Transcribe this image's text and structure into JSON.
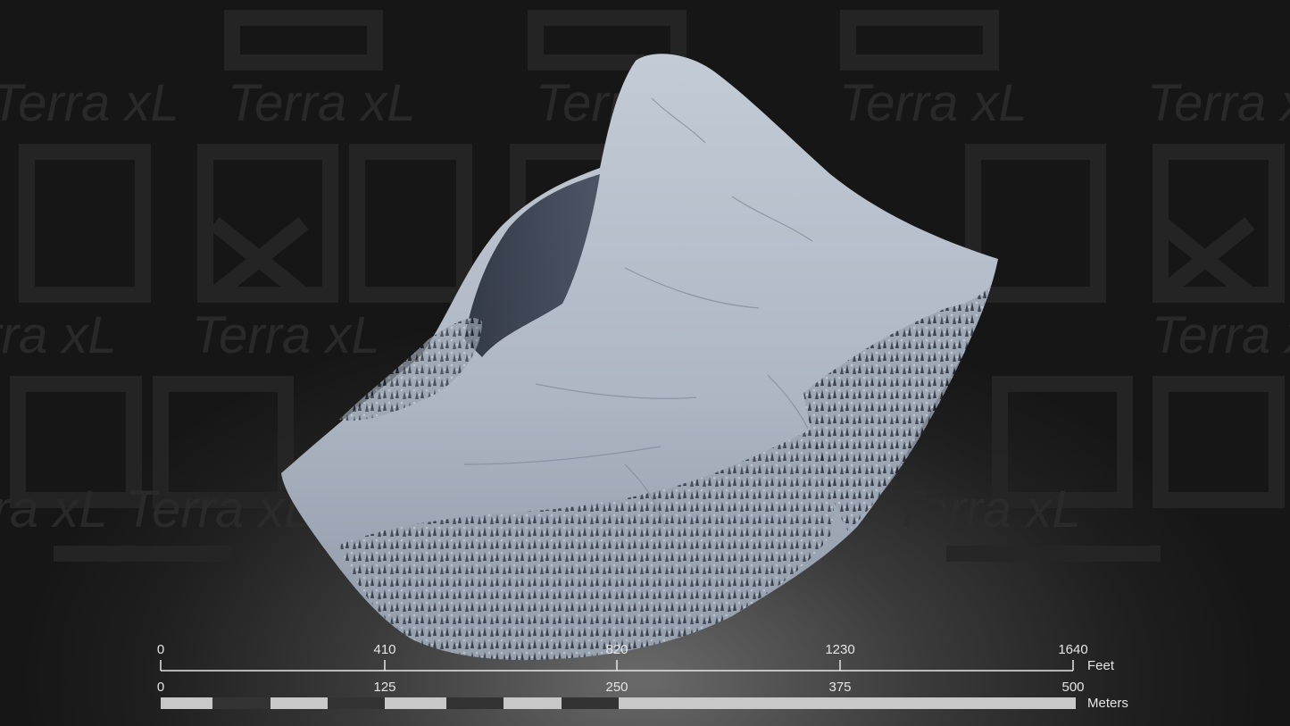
{
  "watermark": {
    "text": "Terra xL"
  },
  "render": {
    "subject": "terrain-model"
  },
  "scale_bar": {
    "feet": {
      "ticks": [
        "0",
        "410",
        "820",
        "1230",
        "1640"
      ],
      "unit": "Feet"
    },
    "meters": {
      "ticks": [
        "0",
        "125",
        "250",
        "375",
        "500"
      ],
      "unit": "Meters"
    }
  },
  "colors": {
    "terrain": "#b9c2cf",
    "background": "#1e1e1e"
  }
}
